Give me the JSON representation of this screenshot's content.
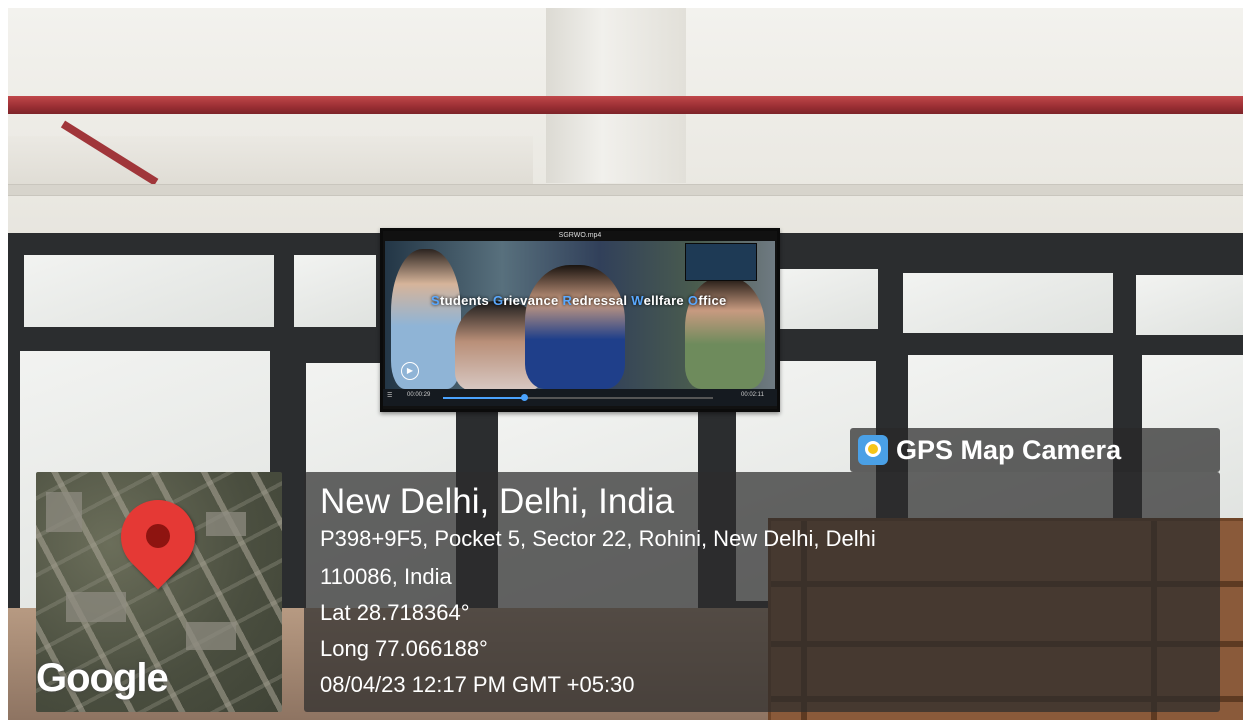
{
  "tv": {
    "file_name": "SGRWO.mp4",
    "caption": "Students Grievance Redressal Wellfare Office",
    "time_elapsed": "00:00:29",
    "time_total": "00:02:11",
    "progress": 0.3
  },
  "stamp": {
    "app_name": "GPS Map Camera",
    "city": "New Delhi, Delhi, India",
    "address_line1": "P398+9F5, Pocket 5, Sector 22, Rohini, New Delhi, Delhi",
    "address_line2": "110086, India",
    "latitude": "Lat 28.718364°",
    "longitude": "Long 77.066188°",
    "datetime": "08/04/23 12:17 PM GMT +05:30"
  },
  "map": {
    "provider": "Google",
    "pin_color": "#e53935"
  }
}
